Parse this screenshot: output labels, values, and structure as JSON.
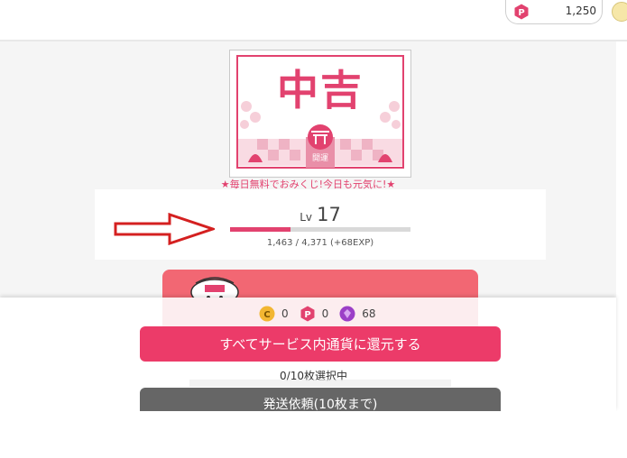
{
  "header": {
    "points_value": "1,250",
    "points_icon": "p-point-icon",
    "coin_icon": "coin-icon"
  },
  "omikuji": {
    "fortune": "中吉",
    "charm_text": "開運",
    "tagline": "★毎日無料でおみくじ!今日も元気に!★"
  },
  "level": {
    "prefix": "Lv",
    "value": "17",
    "progress_text": "1,463 / 4,371 (+68EXP)",
    "progress_fraction": 0.335
  },
  "currencies": [
    {
      "icon": "coin-c-icon",
      "value": "0",
      "color": "#f2b632"
    },
    {
      "icon": "point-p-icon",
      "value": "0",
      "color": "#e2426f"
    },
    {
      "icon": "gem-icon",
      "value": "68",
      "color": "#9b3fc7"
    }
  ],
  "actions": {
    "return_all_label": "すべてサービス内通貨に還元する",
    "selection_status": "0/10枚選択中",
    "ship_request_label": "発送依頼(10枚まで)"
  },
  "colors": {
    "accent": "#e2426f",
    "button_primary": "#ec3b69",
    "button_secondary": "#666666",
    "arrow": "#d42020"
  }
}
